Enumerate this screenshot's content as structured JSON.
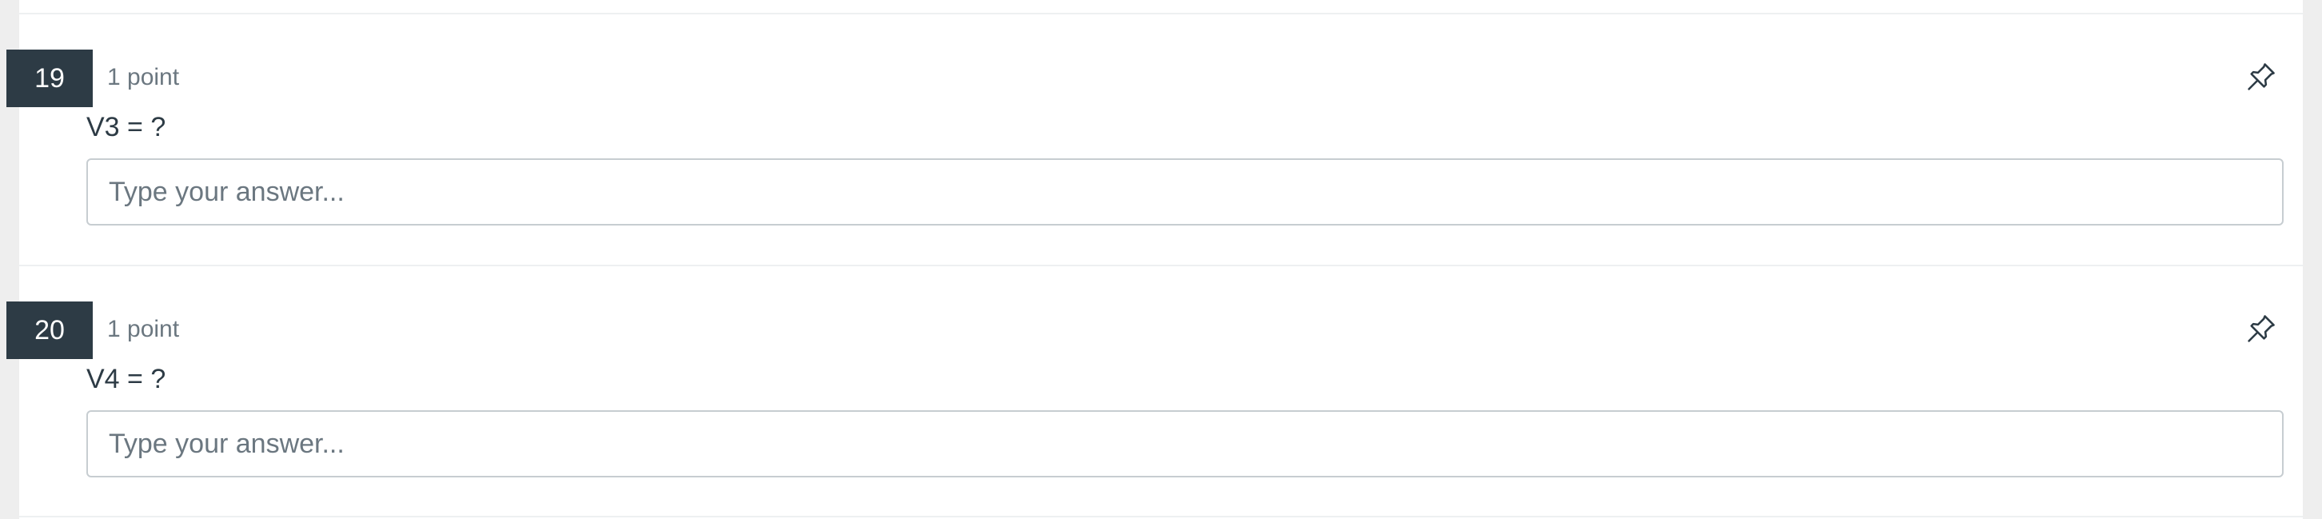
{
  "questions": [
    {
      "number": "19",
      "points": "1 point",
      "prompt": "V3 = ?",
      "answer_value": "",
      "answer_placeholder": "Type your answer...",
      "flag_icon": "pin-icon"
    },
    {
      "number": "20",
      "points": "1 point",
      "prompt": "V4 = ?",
      "answer_value": "",
      "answer_placeholder": "Type your answer...",
      "flag_icon": "pin-icon"
    }
  ],
  "colors": {
    "number_badge_bg": "#2d3b45",
    "text": "#2d3b45",
    "muted_text": "#6b7780",
    "input_border": "#c7cdd1",
    "page_bg": "#eeeeee"
  }
}
